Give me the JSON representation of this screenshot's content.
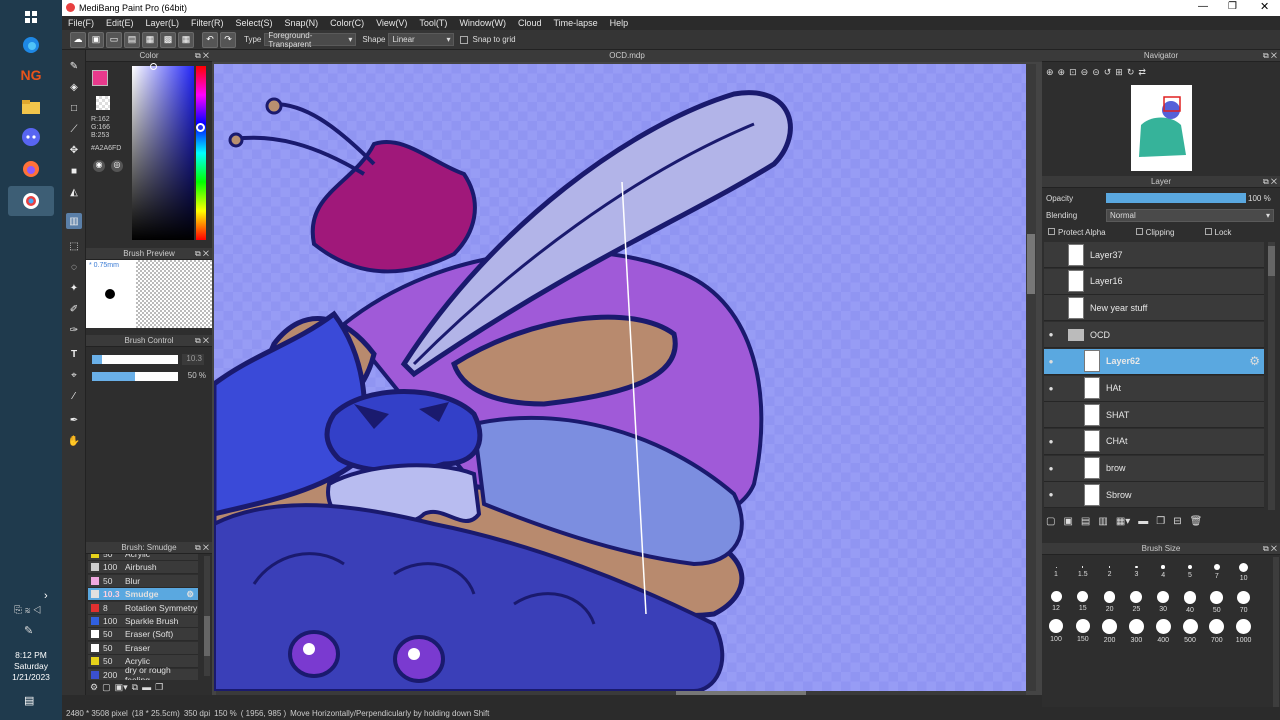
{
  "window": {
    "title": "MediBang Paint Pro (64bit)"
  },
  "menu": [
    "File(F)",
    "Edit(E)",
    "Layer(L)",
    "Filter(R)",
    "Select(S)",
    "Snap(N)",
    "Color(C)",
    "View(V)",
    "Tool(T)",
    "Window(W)",
    "Cloud",
    "Time-lapse",
    "Help"
  ],
  "toolbar": {
    "type_label": "Type",
    "type_value": "Foreground-Transparent",
    "shape_label": "Shape",
    "shape_value": "Linear",
    "snap_label": "Snap to grid"
  },
  "color_panel": {
    "title": "Color",
    "r": "R:162",
    "g": "G:166",
    "b": "B:253",
    "hex": "#A2A6FD",
    "fg_color": "#e83a8c",
    "current_color": "#A2A6FD"
  },
  "brush_preview": {
    "title": "Brush Preview",
    "size": "0.75mm"
  },
  "brush_control": {
    "title": "Brush Control",
    "size_value": "10.3",
    "opacity_value": "50 %",
    "size_fraction": 0.12,
    "opacity_fraction": 0.5
  },
  "brush_list": {
    "title": "Brush: Smudge",
    "items": [
      {
        "num": "50",
        "name": "Acrylic",
        "color": "#e6d21a"
      },
      {
        "num": "100",
        "name": "Airbrush",
        "color": "#cccccc"
      },
      {
        "num": "50",
        "name": "Blur",
        "color": "#f0a8e0"
      },
      {
        "num": "10.3",
        "name": "Smudge",
        "color": "#e0e0e0",
        "selected": true
      },
      {
        "num": "8",
        "name": "Rotation Symmetry",
        "color": "#e03030"
      },
      {
        "num": "100",
        "name": "Sparkle Brush",
        "color": "#3060e0"
      },
      {
        "num": "50",
        "name": "Eraser (Soft)",
        "color": "#ffffff"
      },
      {
        "num": "50",
        "name": "Eraser",
        "color": "#ffffff"
      },
      {
        "num": "50",
        "name": "Acrylic",
        "color": "#e6d21a"
      },
      {
        "num": "200",
        "name": "dry or rough feeling",
        "color": "#3a50d0"
      }
    ]
  },
  "canvas": {
    "tab": "OCD.mdp"
  },
  "navigator": {
    "title": "Navigator"
  },
  "layer_panel": {
    "title": "Layer",
    "opacity_label": "Opacity",
    "opacity_value": "100 %",
    "blending_label": "Blending",
    "blending_value": "Normal",
    "protect_alpha": "Protect Alpha",
    "clipping": "Clipping",
    "lock": "Lock",
    "layers": [
      {
        "name": "Layer37",
        "visible": false,
        "indent": 0
      },
      {
        "name": "Layer16",
        "visible": false,
        "indent": 0
      },
      {
        "name": "New year stuff",
        "visible": false,
        "indent": 0
      },
      {
        "name": "OCD",
        "visible": true,
        "indent": 0,
        "folder": true
      },
      {
        "name": "Layer62",
        "visible": true,
        "indent": 1,
        "selected": true
      },
      {
        "name": "HAt",
        "visible": true,
        "indent": 1
      },
      {
        "name": "SHAT",
        "visible": false,
        "indent": 1
      },
      {
        "name": "CHAt",
        "visible": true,
        "indent": 1
      },
      {
        "name": "brow",
        "visible": true,
        "indent": 1
      },
      {
        "name": "Sbrow",
        "visible": true,
        "indent": 1
      }
    ]
  },
  "brush_size": {
    "title": "Brush Size",
    "sizes": [
      "1",
      "1.5",
      "2",
      "3",
      "4",
      "5",
      "7",
      "10",
      "12",
      "15",
      "20",
      "25",
      "30",
      "40",
      "50",
      "70",
      "100",
      "150",
      "200",
      "300",
      "400",
      "500",
      "700",
      "1000"
    ]
  },
  "status": {
    "dims": "2480 * 3508 pixel",
    "physical": "(18 * 25.5cm)",
    "dpi": "350 dpi",
    "zoom": "150 %",
    "coords": "( 1956, 985 )",
    "hint": "Move Horizontally/Perpendicularly by holding down Shift"
  },
  "clock": {
    "time": "8:12 PM",
    "day": "Saturday",
    "date": "1/21/2023"
  }
}
